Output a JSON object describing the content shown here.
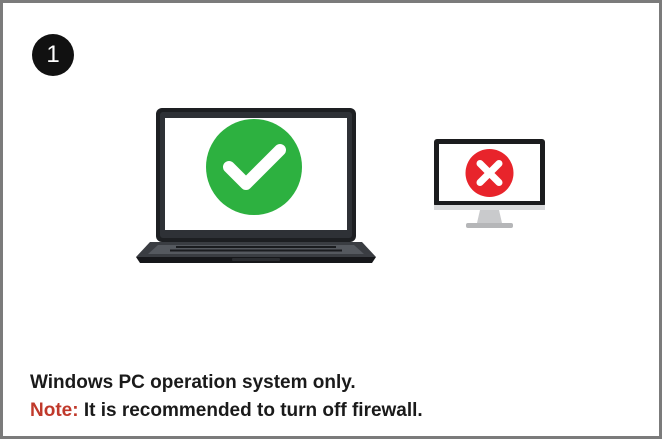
{
  "step": {
    "number": "1"
  },
  "icons": {
    "laptop": "laptop-check-icon",
    "monitor": "monitor-x-icon"
  },
  "colors": {
    "success": "#2db140",
    "error": "#e8242b",
    "note": "#c0392b",
    "badge": "#111111"
  },
  "caption": {
    "line1": "Windows PC operation system only.",
    "note_label": "Note:",
    "note_text": " It is recommended to turn off firewall."
  }
}
